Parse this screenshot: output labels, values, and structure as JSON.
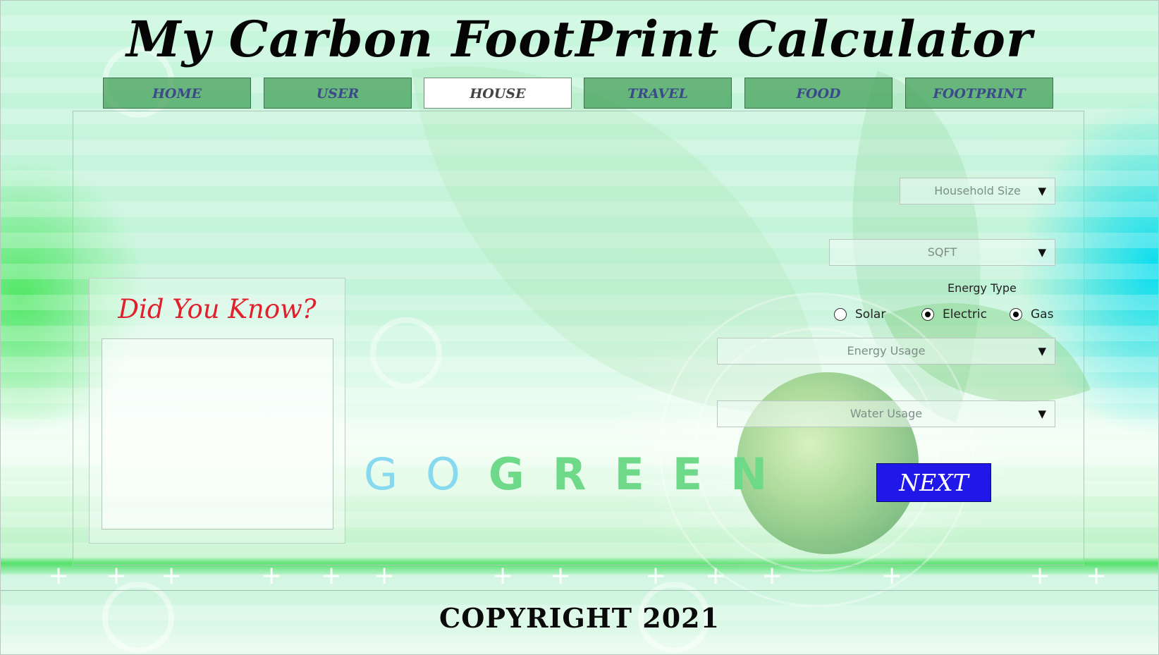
{
  "app": {
    "title": "My Carbon FootPrint Calculator"
  },
  "tabs": [
    {
      "label": "HOME",
      "active": false
    },
    {
      "label": "USER",
      "active": false
    },
    {
      "label": "HOUSE",
      "active": true
    },
    {
      "label": "TRAVEL",
      "active": false
    },
    {
      "label": "FOOD",
      "active": false
    },
    {
      "label": "FOOTPRINT",
      "active": false
    }
  ],
  "did_you_know": {
    "title": "Did You Know?",
    "content": ""
  },
  "form": {
    "household_size": {
      "placeholder": "Household Size"
    },
    "sqft": {
      "placeholder": "SQFT"
    },
    "energy_type": {
      "label": "Energy Type",
      "options": [
        {
          "label": "Solar",
          "selected": false
        },
        {
          "label": "Electric",
          "selected": true
        },
        {
          "label": "Gas",
          "selected": true
        }
      ]
    },
    "energy_usage": {
      "placeholder": "Energy Usage"
    },
    "water_usage": {
      "placeholder": "Water Usage"
    },
    "caret_glyph": "▼"
  },
  "banner": {
    "go": "GO",
    "green": "GREEN"
  },
  "next_button": {
    "label": "NEXT"
  },
  "footer": {
    "copyright": "COPYRIGHT 2021"
  },
  "colors": {
    "tab_bg": "#46a05a",
    "tab_text": "#3b4a8a",
    "next_bg": "#2018e8",
    "dyk_title": "#e0202a",
    "go_color": "#86d9ee",
    "green_color": "#6fd98a"
  }
}
